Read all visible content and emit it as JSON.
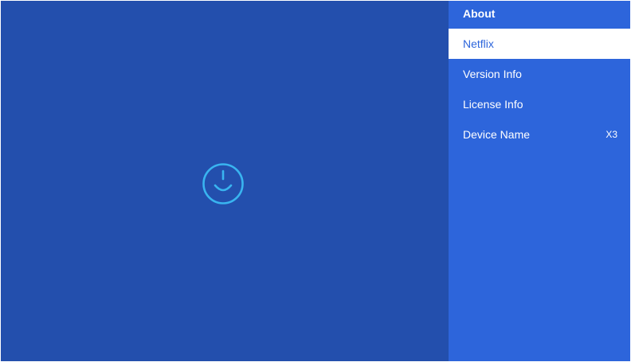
{
  "colors": {
    "left_background": "#234fad",
    "panel_background": "#2d65db",
    "selected_background": "#ffffff",
    "selected_text": "#2d65db",
    "logo_stroke": "#39b4f0"
  },
  "logo": {
    "icon": "smiley-power-icon"
  },
  "menu": {
    "header": "About",
    "items": [
      {
        "label": "Netflix",
        "value": "",
        "selected": true
      },
      {
        "label": "Version Info",
        "value": "",
        "selected": false
      },
      {
        "label": "License Info",
        "value": "",
        "selected": false
      },
      {
        "label": "Device Name",
        "value": "X3",
        "selected": false
      }
    ]
  }
}
